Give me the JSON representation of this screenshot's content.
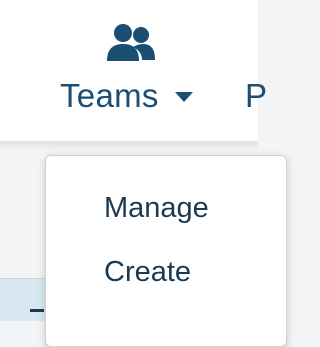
{
  "nav": {
    "teams": {
      "label": "Teams",
      "icon": "people-icon",
      "color": "#1b4e73"
    },
    "next_item_partial": "P"
  },
  "dropdown": {
    "items": [
      {
        "label": "Manage"
      },
      {
        "label": "Create"
      }
    ]
  },
  "colors": {
    "nav_text": "#1b4e73",
    "menu_text": "#1b3a52",
    "page_background": "#f3f4f5",
    "table_highlight": "#d8e7f0"
  }
}
